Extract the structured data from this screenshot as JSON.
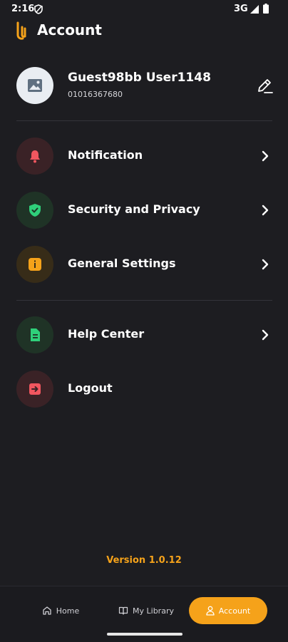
{
  "status_bar": {
    "time": "2:16",
    "network": "3G"
  },
  "header": {
    "title": "Account"
  },
  "profile": {
    "name": "Guest98bb User1148",
    "phone": "01016367680"
  },
  "menu": [
    {
      "label": "Notification",
      "icon": "bell-icon",
      "color": "#f0565f",
      "bg": "#3a2226"
    },
    {
      "label": "Security and Privacy",
      "icon": "shield-check-icon",
      "color": "#2fd07a",
      "bg": "#1f3326"
    },
    {
      "label": "General Settings",
      "icon": "info-icon",
      "color": "#f5a21a",
      "bg": "#372c18"
    },
    {
      "label": "Help Center",
      "icon": "document-icon",
      "color": "#2fd07a",
      "bg": "#1f3326"
    },
    {
      "label": "Logout",
      "icon": "logout-icon",
      "color": "#f0565f",
      "bg": "#3a2226"
    }
  ],
  "version": "Version 1.0.12",
  "bottom_nav": [
    {
      "label": "Home",
      "icon": "home-icon",
      "active": false
    },
    {
      "label": "My Library",
      "icon": "book-icon",
      "active": false
    },
    {
      "label": "Account",
      "icon": "user-icon",
      "active": true
    }
  ],
  "colors": {
    "background": "#1d1d21",
    "accent": "#f5a21a"
  }
}
